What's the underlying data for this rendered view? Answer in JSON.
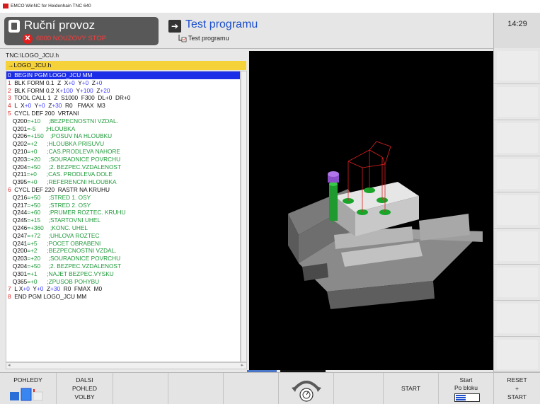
{
  "window": {
    "title": "EMCO WinNC for Heidenhain TNC 640"
  },
  "header": {
    "mode_title": "Ruční provoz",
    "estop_text": "6000 NOUZOVÝ STOP",
    "program_title": "Test programu",
    "program_subtitle": "Test programu",
    "clock": "14:29"
  },
  "editor": {
    "path": "TNC:\\LOGO_JCU.h",
    "file_tab": "→LOGO_JCU.h",
    "lines": [
      "0  BEGIN PGM LOGO_JCU MM",
      "1  BLK FORM 0.1  Z  X+0  Y+0  Z+0",
      "2  BLK FORM 0.2 X+100  Y+100  Z+20",
      "3  TOOL CALL 1  Z  S1000  F300  DL+0  DR+0",
      "4  L  X+0  Y+0  Z+30  R0   FMAX  M3",
      "5  CYCL DEF 200  VRTANI",
      "   Q200=+10     ;BEZPECNOSTNI VZDAL.",
      "   Q201=-5      ;HLOUBKA",
      "   Q206=+150    ;POSUV NA HLOUBKU",
      "   Q202=+2      ;HLOUBKA PRISUVU",
      "   Q210=+0      ;CAS.PRODLEVA NAHORE",
      "   Q203=+20     ;SOURADNICE POVRCHU",
      "   Q204=+50     ;2. BEZPEC.VZDALENOST",
      "   Q211=+0      ;CAS. PRODLEVA DOLE",
      "   Q395=+0      ;REFERENCNI HLOUBKA",
      "6  CYCL DEF 220  RASTR NA KRUHU",
      "   Q216=+50     ;STRED 1. OSY",
      "   Q217=+50     ;STRED 2. OSY",
      "   Q244=+60     ;PRUMER ROZTEC. KRUHU",
      "   Q245=+15     ;STARTOVNI UHEL",
      "   Q246=+360    ;KONC. UHEL",
      "   Q247=+72     ;UHLOVA ROZTEC",
      "   Q241=+5      ;POCET OBRABENI",
      "   Q200=+2      ;BEZPECNOSTNI VZDAL.",
      "   Q203=+20     ;SOURADNICE POVRCHU",
      "   Q204=+50     ;2. BEZPEC.VZDALENOST",
      "   Q301=+1      ;NAJET BEZPEC.VYSKU",
      "   Q365=+0      ;ZPUSOB POHYBU",
      "7  L X+0  Y+0  Z+30  R0  FMAX  M0",
      "8  END PGM LOGO_JCU MM"
    ]
  },
  "bottom_softkeys": [
    {
      "line1": "POHLEDY",
      "line2": "",
      "line3": ""
    },
    {
      "line1": "DALSI",
      "line2": "POHLED",
      "line3": "VOLBY"
    },
    {
      "line1": "",
      "line2": "",
      "line3": ""
    },
    {
      "line1": "",
      "line2": "",
      "line3": ""
    },
    {
      "line1": "",
      "line2": "",
      "line3": ""
    },
    {
      "line1": "",
      "line2": "",
      "line3": ""
    },
    {
      "line1": "",
      "line2": "",
      "line3": ""
    },
    {
      "line1": "START",
      "line2": "",
      "line3": ""
    },
    {
      "line1": "Start",
      "line2": "Po bloku",
      "line3": ""
    },
    {
      "line1": "RESET",
      "line2": "+",
      "line3": "START"
    }
  ],
  "colors": {
    "selection": "#1c2de8",
    "file_tab": "#f5d13a",
    "estop": "#ff3a3a",
    "program_title": "#1a4dcc",
    "part_highlight": "#18a52a",
    "tool_tip": "#9b4fd0",
    "path_lines": "#e02020"
  },
  "icons": [
    "stop-icon",
    "mode-icon",
    "program-mode-icon",
    "views-icon",
    "feed-override-dial-icon",
    "block-icon"
  ]
}
